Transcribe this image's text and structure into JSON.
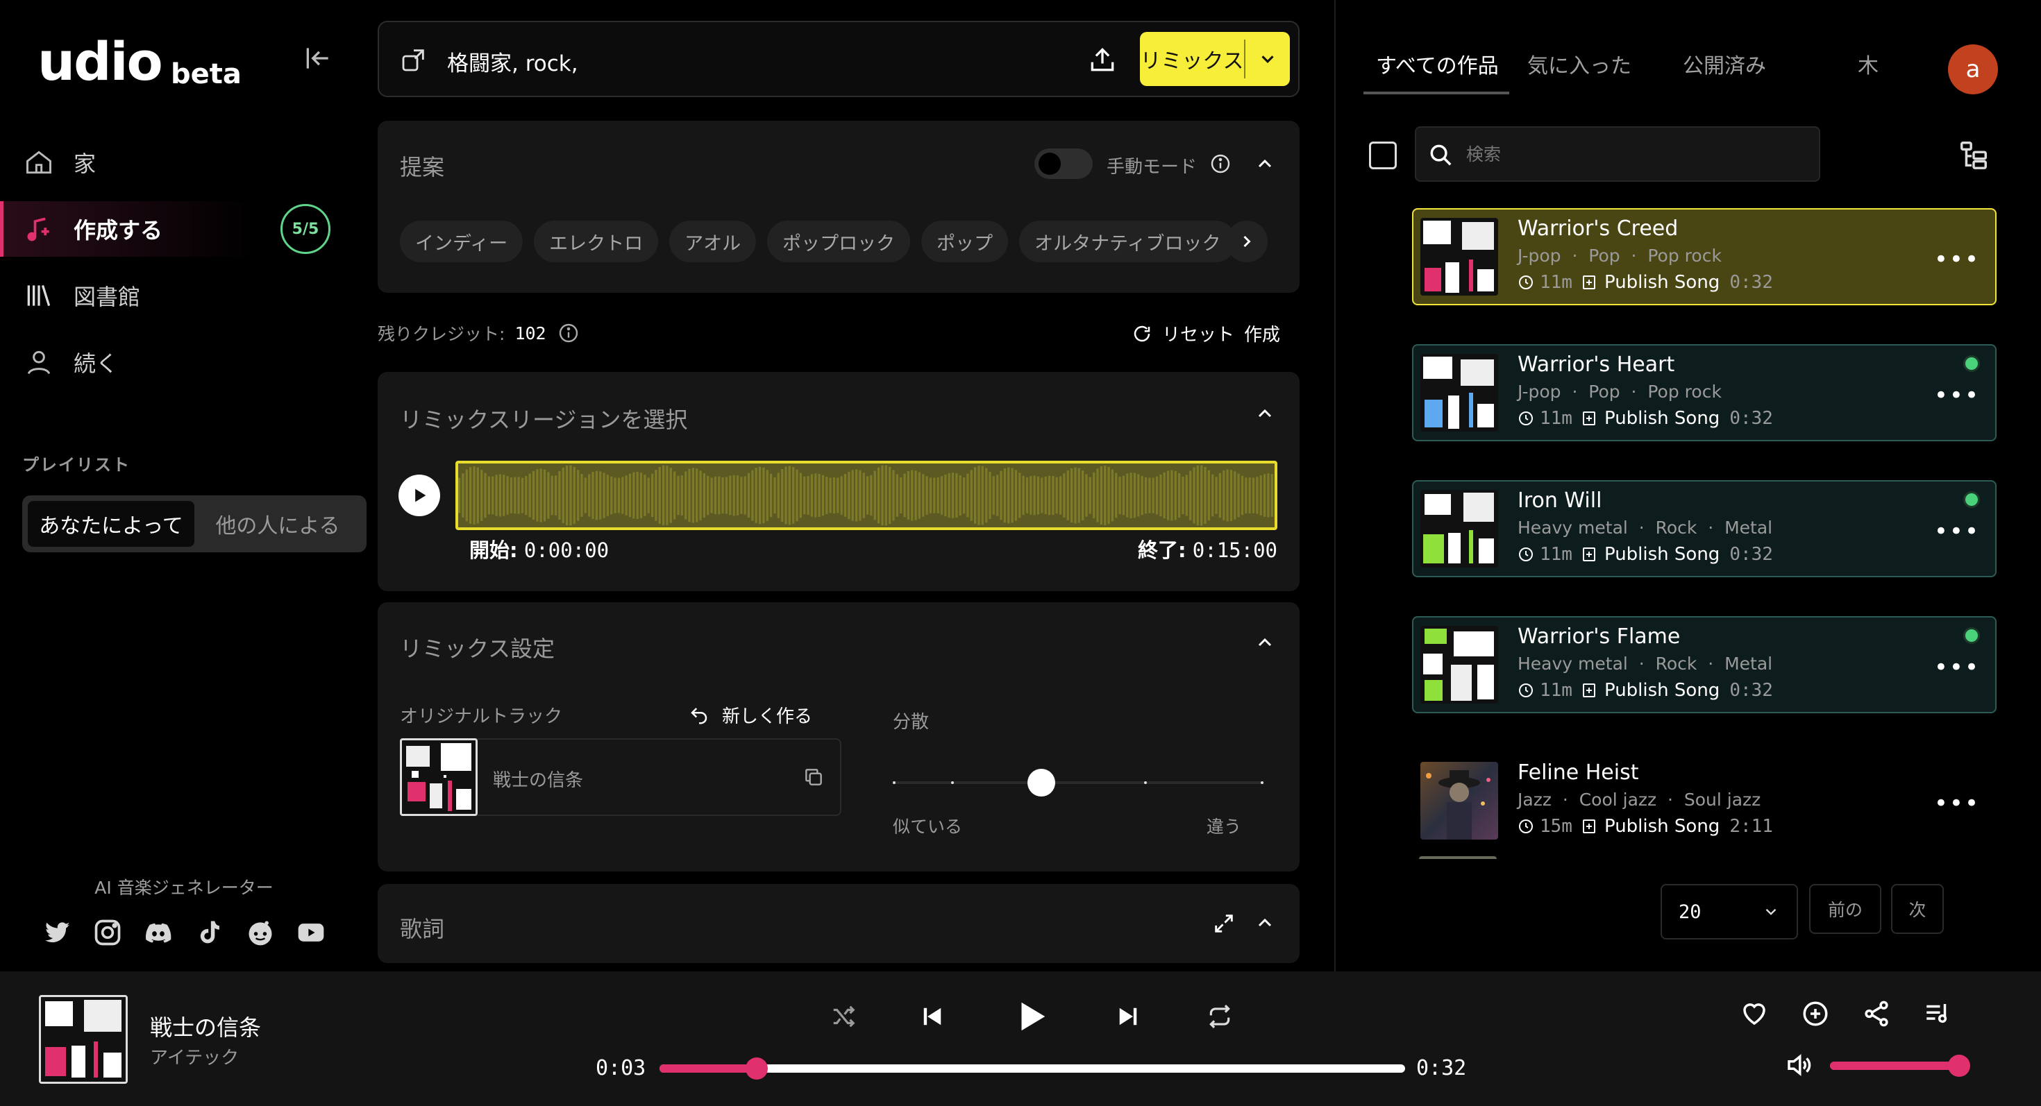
{
  "sidebar": {
    "logo": "udio",
    "logo_badge": "beta",
    "nav": [
      {
        "label": "家",
        "icon": "home-icon"
      },
      {
        "label": "作成する",
        "icon": "music-plus-icon",
        "badge": "5/5"
      },
      {
        "label": "図書館",
        "icon": "library-icon"
      },
      {
        "label": "続く",
        "icon": "user-icon"
      }
    ],
    "playlists_label": "プレイリスト",
    "playlist_tabs": [
      "あなたによって",
      "他の人による"
    ],
    "ai_label": "AI 音楽ジェネレーター",
    "socials": [
      "twitter-icon",
      "instagram-icon",
      "discord-icon",
      "tiktok-icon",
      "reddit-icon",
      "youtube-icon"
    ]
  },
  "prompt": {
    "text": "格闘家, rock,",
    "remix_label": "リミックス"
  },
  "suggestions": {
    "title": "提案",
    "manual_mode": "手動モード",
    "chips": [
      "インディー",
      "エレクトロ",
      "アオル",
      "ポップロック",
      "ポップ",
      "オルタナティブロック"
    ]
  },
  "credits": {
    "label": "残りクレジット:",
    "value": "102",
    "reset": "リセット",
    "create": "作成"
  },
  "region": {
    "title": "リミックスリージョンを選択",
    "start_label": "開始:",
    "start_value": "0:00:00",
    "end_label": "終了:",
    "end_value": "0:15:00"
  },
  "remix_settings": {
    "title": "リミックス設定",
    "original_label": "オリジナルトラック",
    "new_label": "新しく作る",
    "track_name": "戦士の信条",
    "variance_label": "分散",
    "similar": "似ている",
    "different": "違う",
    "variance_value": 0.4
  },
  "lyrics": {
    "title": "歌詞"
  },
  "right": {
    "tabs": [
      "すべての作品",
      "気に入った",
      "公開済み",
      "木"
    ],
    "avatar": "a",
    "search_placeholder": "検索",
    "songs": [
      {
        "title": "Warrior's Creed",
        "tags": [
          "J-pop",
          "Pop",
          "Pop rock"
        ],
        "age": "11m",
        "publish": "Publish Song",
        "duration": "0:32",
        "state": "selected"
      },
      {
        "title": "Warrior's Heart",
        "tags": [
          "J-pop",
          "Pop",
          "Pop rock"
        ],
        "age": "11m",
        "publish": "Publish Song",
        "duration": "0:32",
        "state": "new"
      },
      {
        "title": "Iron Will",
        "tags": [
          "Heavy metal",
          "Rock",
          "Metal"
        ],
        "age": "11m",
        "publish": "Publish Song",
        "duration": "0:32",
        "state": "new"
      },
      {
        "title": "Warrior's Flame",
        "tags": [
          "Heavy metal",
          "Rock",
          "Metal"
        ],
        "age": "11m",
        "publish": "Publish Song",
        "duration": "0:32",
        "state": "new"
      },
      {
        "title": "Feline Heist",
        "tags": [
          "Jazz",
          "Cool jazz",
          "Soul jazz"
        ],
        "age": "15m",
        "publish": "Publish Song",
        "duration": "2:11",
        "state": "plain"
      }
    ],
    "page_size": "20",
    "prev": "前の",
    "next": "次"
  },
  "player": {
    "title": "戦士の信条",
    "artist": "アイテック",
    "elapsed": "0:03",
    "total": "0:32",
    "progress": 0.13,
    "volume": 0.95
  },
  "colors": {
    "accent": "#e0306e",
    "remix_button": "#f7ee3a",
    "badge_green": "#5fd48a"
  }
}
